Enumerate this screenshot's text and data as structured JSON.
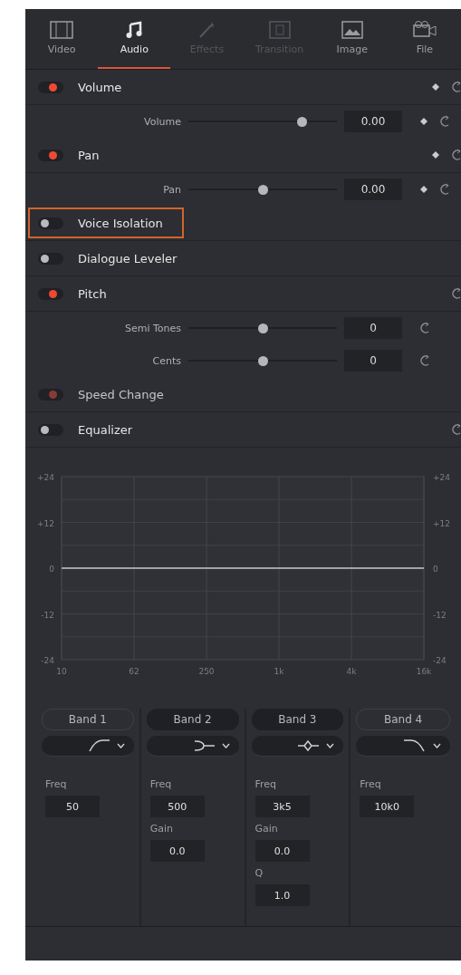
{
  "tabs": [
    {
      "label": "Video",
      "selected": false,
      "disabled": false
    },
    {
      "label": "Audio",
      "selected": true,
      "disabled": false
    },
    {
      "label": "Effects",
      "selected": false,
      "disabled": true
    },
    {
      "label": "Transition",
      "selected": false,
      "disabled": true
    },
    {
      "label": "Image",
      "selected": false,
      "disabled": false
    },
    {
      "label": "File",
      "selected": false,
      "disabled": false
    }
  ],
  "sections": [
    {
      "title": "Volume",
      "on": true,
      "keyframe": true,
      "reset": true,
      "params": [
        {
          "label": "Volume",
          "level": 0.76,
          "value": "0.00",
          "keyframe": true
        }
      ]
    },
    {
      "title": "Pan",
      "on": true,
      "keyframe": true,
      "reset": true,
      "params": [
        {
          "label": "Pan",
          "level": 0.5,
          "value": "0.00",
          "keyframe": true
        }
      ]
    },
    {
      "title": "Voice Isolation",
      "on": false,
      "highlighted": true
    },
    {
      "title": "Dialogue Leveler",
      "on": false
    },
    {
      "title": "Pitch",
      "on": true,
      "reset": true,
      "params": [
        {
          "label": "Semi Tones",
          "level": 0.5,
          "value": "0"
        },
        {
          "label": "Cents",
          "level": 0.5,
          "value": "0"
        }
      ]
    },
    {
      "title": "Speed Change",
      "on": true,
      "disabled": true
    },
    {
      "title": "Equalizer",
      "on": false,
      "reset": true
    }
  ],
  "equalizer": {
    "chart_data": {
      "type": "line",
      "grid": true,
      "categories": [
        "10",
        "62",
        "250",
        "1k",
        "4k",
        "16k"
      ],
      "series": [
        {
          "color": "#c8c8c8",
          "values": [
            0,
            0,
            0,
            0,
            0,
            0
          ]
        }
      ],
      "ylim": [
        -24,
        24
      ],
      "yticks": [
        {
          "value": 24,
          "label": "+24"
        },
        {
          "value": 12,
          "label": "+12"
        },
        {
          "value": 0,
          "label": "0"
        },
        {
          "value": -12,
          "label": "-12"
        },
        {
          "value": -24,
          "label": "-24"
        }
      ]
    },
    "right_axis_labels": [
      "+24",
      "+12",
      "0",
      "-12",
      "-24"
    ],
    "bands": [
      {
        "label": "Band 1",
        "on": false,
        "kind": "lowcut",
        "fields": [
          {
            "label": "Freq",
            "value": "50"
          }
        ]
      },
      {
        "label": "Band 2",
        "on": true,
        "kind": "lowshelf",
        "fields": [
          {
            "label": "Freq",
            "value": "500"
          },
          {
            "label": "Gain",
            "value": "0.0"
          }
        ]
      },
      {
        "label": "Band 3",
        "on": true,
        "kind": "bell",
        "fields": [
          {
            "label": "Freq",
            "value": "3k5"
          },
          {
            "label": "Gain",
            "value": "0.0"
          },
          {
            "label": "Q",
            "value": "1.0"
          }
        ]
      },
      {
        "label": "Band 4",
        "on": false,
        "kind": "highcut",
        "fields": [
          {
            "label": "Freq",
            "value": "10k0"
          }
        ]
      }
    ]
  }
}
